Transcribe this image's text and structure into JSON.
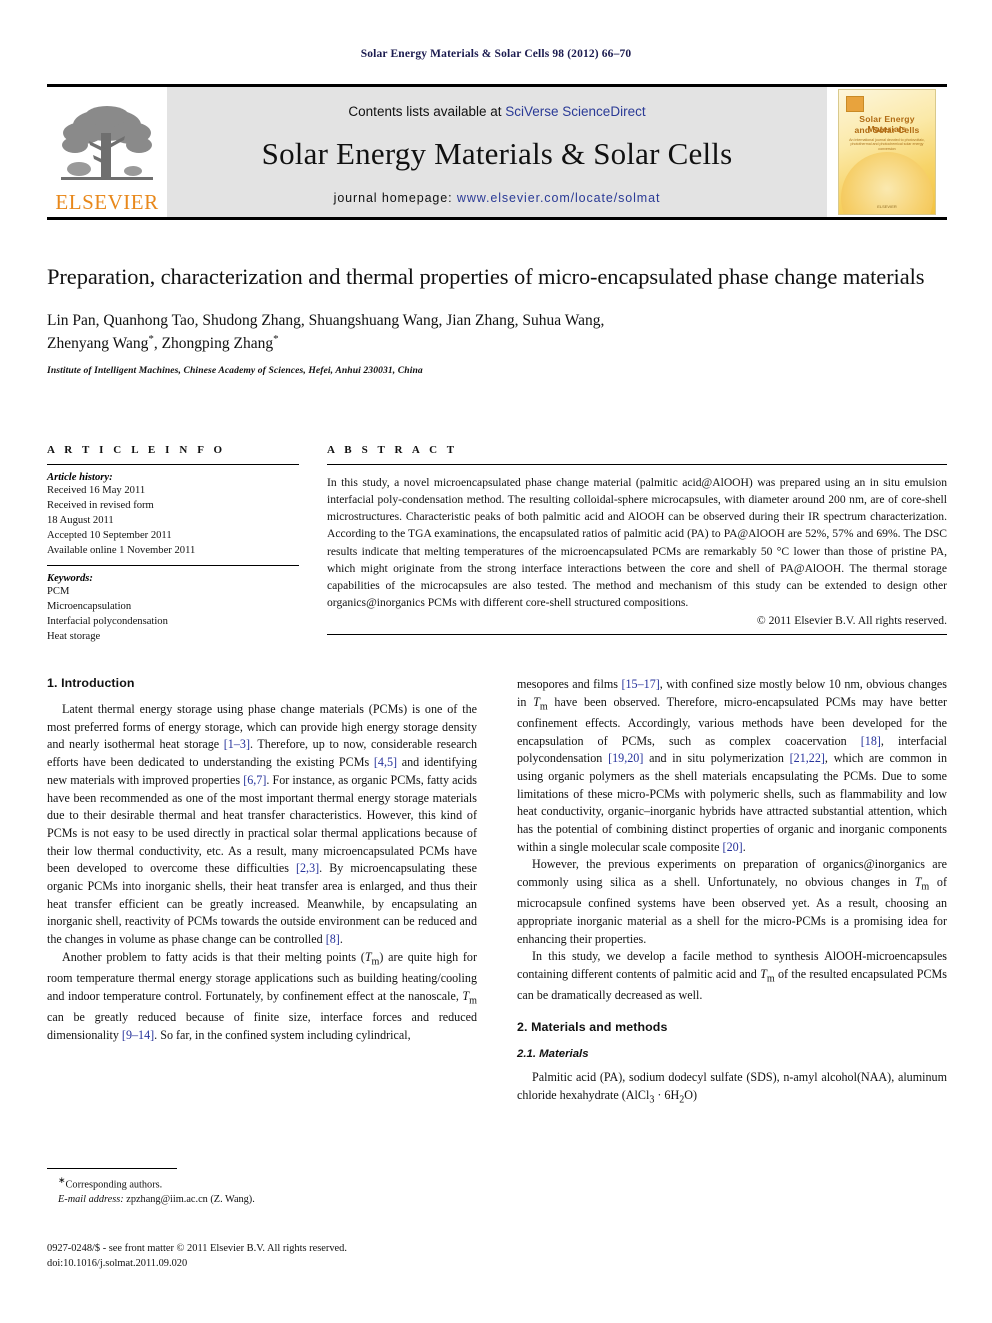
{
  "running_head": "Solar Energy Materials & Solar Cells 98 (2012) 66–70",
  "masthead": {
    "publisher_name": "ELSEVIER",
    "contents_prefix": "Contents lists available at ",
    "contents_link": "SciVerse ScienceDirect",
    "journal_title": "Solar Energy Materials & Solar Cells",
    "homepage_prefix": "journal homepage: ",
    "homepage_link": "www.elsevier.com/locate/solmat",
    "cover": {
      "line1": "Solar Energy Materials",
      "line2": "and Solar Cells",
      "subtitle": "An international journal devoted to photovoltaic, photothermal and photochemical solar energy conversion",
      "footer": "ELSEVIER"
    }
  },
  "article": {
    "title": "Preparation, characterization and thermal properties of micro-encapsulated phase change materials",
    "authors_line1": "Lin Pan, Quanhong Tao, Shudong Zhang, Shuangshuang Wang, Jian Zhang, Suhua Wang,",
    "authors_line2_a": "Zhenyang Wang",
    "authors_line2_b": ", Zhongping Zhang",
    "author_star": "*",
    "affiliation": "Institute of Intelligent Machines, Chinese Academy of Sciences, Hefei, Anhui 230031, China"
  },
  "article_info": {
    "heading": "A R T I C L E   I N F O",
    "history_label": "Article history:",
    "history": [
      "Received 16 May 2011",
      "Received in revised form",
      "18 August 2011",
      "Accepted 10 September 2011",
      "Available online 1 November 2011"
    ],
    "keywords_label": "Keywords:",
    "keywords": [
      "PCM",
      "Microencapsulation",
      "Interfacial polycondensation",
      "Heat storage"
    ]
  },
  "abstract": {
    "heading": "A B S T R A C T",
    "text": "In this study, a novel microencapsulated phase change material (palmitic acid@AlOOH) was prepared using an in situ emulsion interfacial poly-condensation method. The resulting colloidal-sphere microcapsules, with diameter around 200 nm, are of core-shell microstructures. Characteristic peaks of both palmitic acid and AlOOH can be observed during their IR spectrum characterization. According to the TGA examinations, the encapsulated ratios of palmitic acid (PA) to PA@AlOOH are 52%, 57% and 69%. The DSC results indicate that melting temperatures of the microencapsulated PCMs are remarkably 50 °C lower than those of pristine PA, which might originate from the strong interface interactions between the core and shell of PA@AlOOH. The thermal storage capabilities of the microcapsules are also tested. The method and mechanism of this study can be extended to design other organics@inorganics PCMs with different core-shell structured compositions.",
    "copyright": "© 2011 Elsevier B.V. All rights reserved."
  },
  "sections": {
    "intro_heading": "1.  Introduction",
    "materials_heading": "2.  Materials and methods",
    "materials_sub": "2.1.  Materials"
  },
  "body": {
    "left": [
      "Latent thermal energy storage using phase change materials (PCMs) is one of the most preferred forms of energy storage, which can provide high energy storage density and nearly isothermal heat storage [1–3]. Therefore, up to now, considerable research efforts have been dedicated to understanding the existing PCMs [4,5] and identifying new materials with improved properties [6,7]. For instance, as organic PCMs, fatty acids have been recommended as one of the most important thermal energy storage materials due to their desirable thermal and heat transfer characteristics. However, this kind of PCMs is not easy to be used directly in practical solar thermal applications because of their low thermal conductivity, etc. As a result, many microencapsulated PCMs have been developed to overcome these difficulties [2,3]. By microencapsulating these organic PCMs into inorganic shells, their heat transfer area is enlarged, and thus their heat transfer efficient can be greatly increased. Meanwhile, by encapsulating an inorganic shell, reactivity of PCMs towards the outside environment can be reduced and the changes in volume as phase change can be controlled [8].",
      "Another problem to fatty acids is that their melting points (Tm) are quite high for room temperature thermal energy storage applications such as building heating/cooling and indoor temperature control. Fortunately, by confinement effect at the nanoscale, Tm can be greatly reduced because of finite size, interface forces and reduced dimensionality [9–14]. So far, in the confined system including cylindrical,"
    ],
    "right": [
      "mesopores and films [15–17], with confined size mostly below 10 nm, obvious changes in Tm have been observed. Therefore, micro-encapsulated PCMs may have better confinement effects. Accordingly, various methods have been developed for the encapsulation of PCMs, such as complex coacervation [18], interfacial polycondensation [19,20] and in situ polymerization [21,22], which are common in using organic polymers as the shell materials encapsulating the PCMs. Due to some limitations of these micro-PCMs with polymeric shells, such as flammability and low heat conductivity, organic–inorganic hybrids have attracted substantial attention, which has the potential of combining distinct properties of organic and inorganic components within a single molecular scale composite [20].",
      "However, the previous experiments on preparation of organics@inorganics are commonly using silica as a shell. Unfortunately, no obvious changes in Tm of microcapsule confined systems have been observed yet. As a result, choosing an appropriate inorganic material as a shell for the micro-PCMs is a promising idea for enhancing their properties.",
      "In this study, we develop a facile method to synthesis AlOOH-microencapsules containing different contents of palmitic acid and Tm of the resulted encapsulated PCMs can be dramatically decreased as well.",
      "Palmitic acid (PA), sodium dodecyl sulfate (SDS), n-amyl alcohol(NAA), aluminum chloride hexahydrate (AlCl3 · 6H2O)"
    ]
  },
  "footnote": {
    "corresponding": "Corresponding authors.",
    "email_label": "E-mail address:",
    "email": "zpzhang@iim.ac.cn (Z. Wang)."
  },
  "imprint": {
    "line1": "0927-0248/$ - see front matter © 2011 Elsevier B.V. All rights reserved.",
    "line2": "doi:10.1016/j.solmat.2011.09.020"
  },
  "colors": {
    "link_blue": "#2A3A96",
    "reference_blue": "#27339B",
    "elsevier_orange": "#E8881B",
    "masthead_gray": "#e3e3e3"
  }
}
